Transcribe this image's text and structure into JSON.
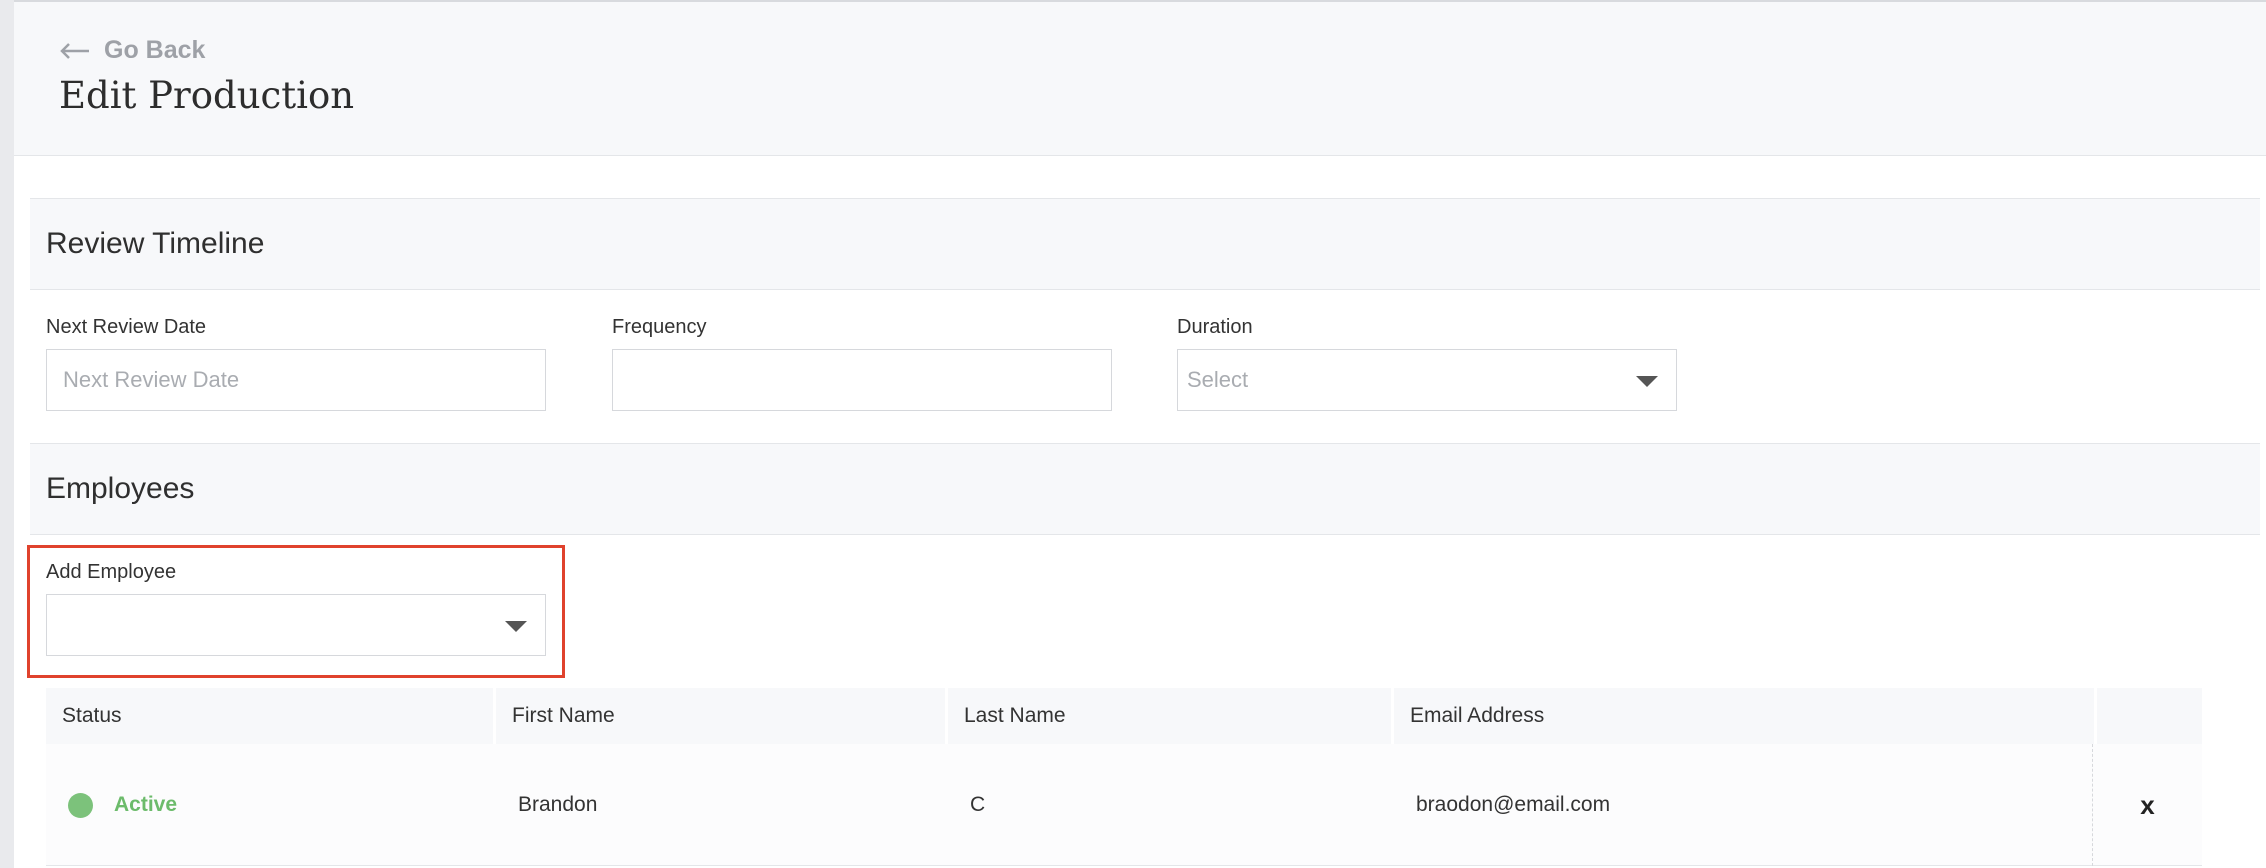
{
  "header": {
    "back_label": "Go Back",
    "title": "Edit Production"
  },
  "review_timeline": {
    "title": "Review Timeline",
    "next_review_date": {
      "label": "Next Review Date",
      "value": "",
      "placeholder": "Next Review Date"
    },
    "frequency": {
      "label": "Frequency",
      "value": ""
    },
    "duration": {
      "label": "Duration",
      "selected": "Select"
    }
  },
  "employees": {
    "title": "Employees",
    "add_employee": {
      "label": "Add Employee",
      "selected": ""
    },
    "table": {
      "columns": [
        "Status",
        "First Name",
        "Last Name",
        "Email Address",
        ""
      ],
      "rows": [
        {
          "status": "Active",
          "first_name": "Brandon",
          "last_name": "C",
          "email": "braodon@email.com",
          "remove": "x"
        }
      ]
    }
  },
  "colors": {
    "status_active": "#6cbb6b",
    "highlight": "#e0422d",
    "band": "#f7f8fa"
  }
}
